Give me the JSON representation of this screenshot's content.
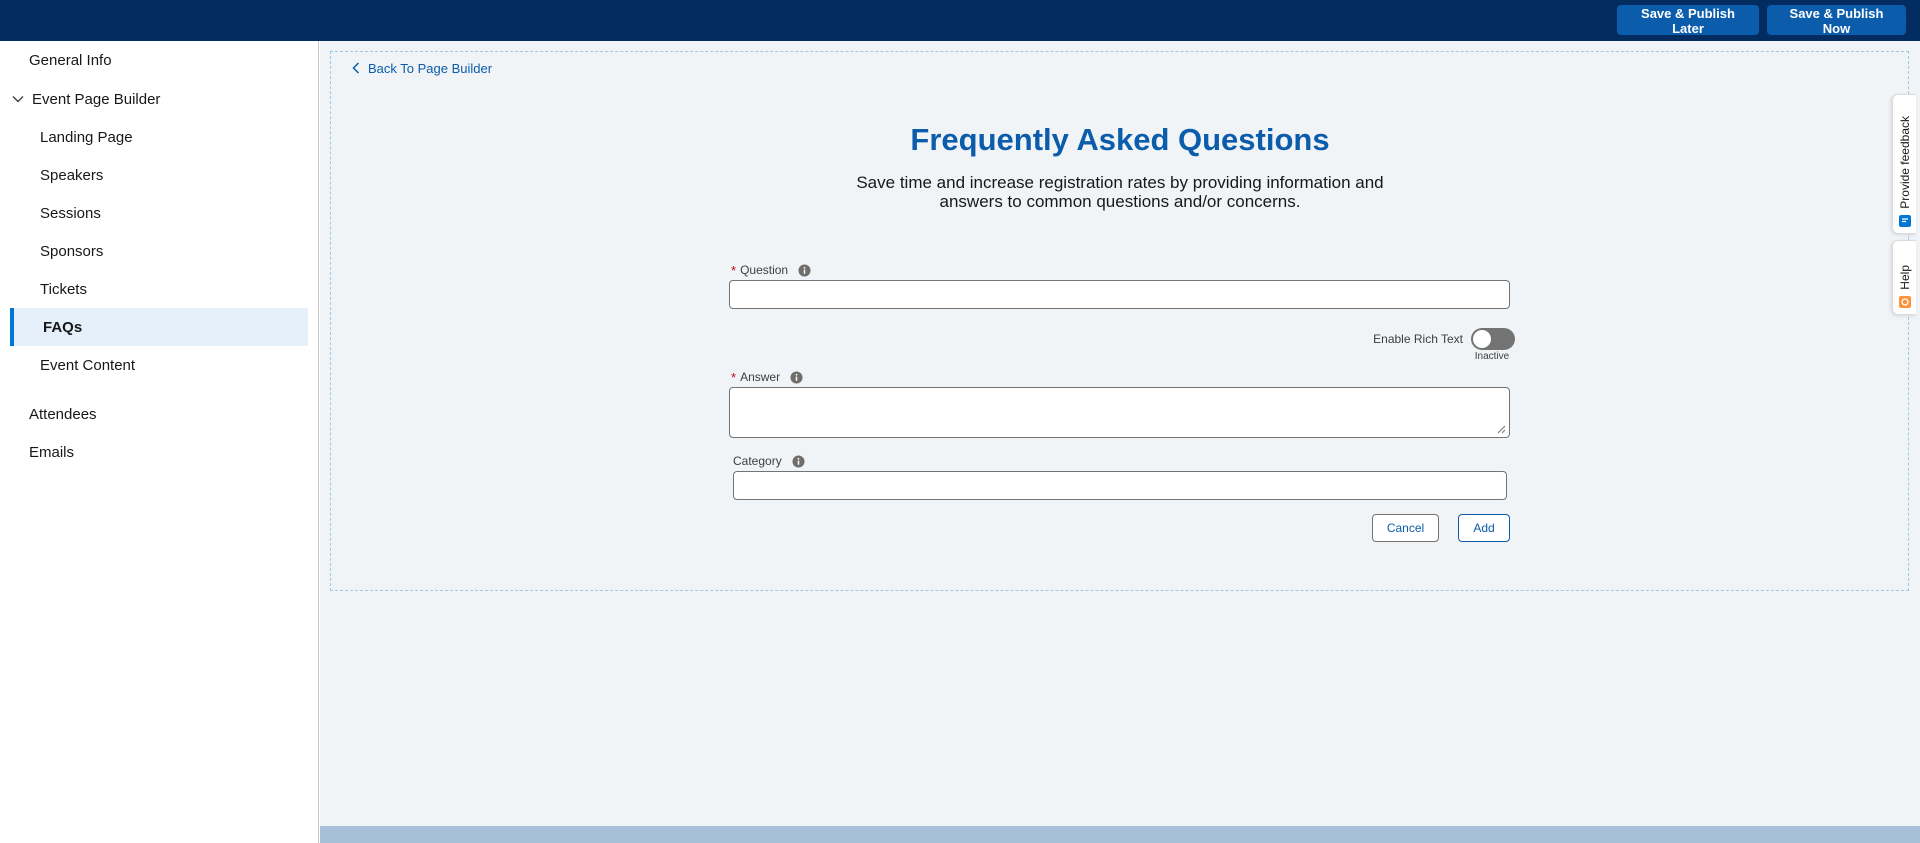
{
  "topbar": {
    "publish_later_label": "Save & Publish Later",
    "publish_now_label": "Save & Publish Now"
  },
  "sidebar": {
    "general_info": "General Info",
    "event_page_builder": "Event Page Builder",
    "sub_items": {
      "landing_page": "Landing Page",
      "speakers": "Speakers",
      "sessions": "Sessions",
      "sponsors": "Sponsors",
      "tickets": "Tickets",
      "faqs": "FAQs",
      "event_content": "Event Content"
    },
    "attendees": "Attendees",
    "emails": "Emails",
    "active_item": "FAQs"
  },
  "main": {
    "back_link": "Back To Page Builder",
    "title": "Frequently Asked Questions",
    "subtitle": "Save time and increase registration rates by providing information and answers to common questions and/or concerns."
  },
  "form": {
    "question_label": "Question",
    "question_value": "",
    "rich_text_label": "Enable Rich Text",
    "rich_text_status": "Inactive",
    "answer_label": "Answer",
    "answer_value": "",
    "category_label": "Category",
    "category_value": "",
    "required_mark": "*",
    "cancel_label": "Cancel",
    "add_label": "Add"
  },
  "side_tabs": {
    "feedback": "Provide feedback",
    "help": "Help"
  },
  "colors": {
    "brand_dark": "#032d60",
    "brand_button": "#0b5cab",
    "active_accent": "#0176d3",
    "title_color": "#0b5cab",
    "required": "#ba0517",
    "toggle_off": "#747474"
  },
  "icons": {
    "back": "chevron-left-icon",
    "group": "chevron-down-icon",
    "info": "info-icon",
    "feedback": "feedback-icon",
    "help": "help-icon"
  }
}
